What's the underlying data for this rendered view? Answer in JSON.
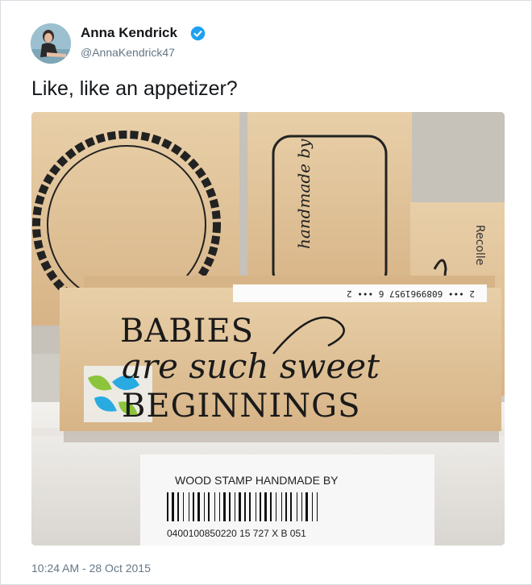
{
  "author": {
    "display_name": "Anna Kendrick",
    "handle": "@AnnaKendrick47",
    "verified": true,
    "verified_color": "#1da1f2"
  },
  "tweet": {
    "text": "Like, like an appetizer?",
    "timestamp": "10:24 AM - 28 Oct 2015"
  },
  "photo": {
    "stamp_line1": "BABIES",
    "stamp_line2": "are such sweet",
    "stamp_line3": "BEGINNINGS",
    "back_stamp_text": "handmade by",
    "right_stamp_text": "Recolle",
    "sticker_code": "2 ••• 6089961957 6 ••• 2",
    "label_title": "WOOD STAMP HANDMADE BY",
    "label_number": "0400100850220 15 727 X B 051"
  }
}
